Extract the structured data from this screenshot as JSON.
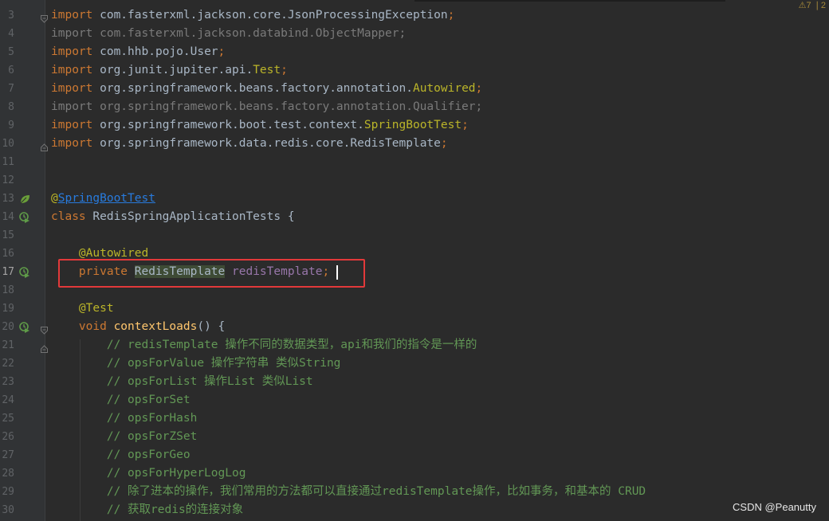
{
  "watermark": "CSDN @Peanutty",
  "top_right_indicator": "⚠7 ❘2",
  "lines": [
    {
      "n": "3",
      "segments": [
        {
          "t": "import",
          "c": "kw"
        },
        {
          "t": " com.fasterxml.jackson.core.JsonProcessingException"
        },
        {
          "t": ";",
          "c": "kw"
        }
      ],
      "fold": "open"
    },
    {
      "n": "4",
      "segments": [
        {
          "t": "import com.fasterxml.jackson.databind.ObjectMapper;",
          "c": "dim"
        }
      ]
    },
    {
      "n": "5",
      "segments": [
        {
          "t": "import",
          "c": "kw"
        },
        {
          "t": " com.hhb.pojo.User"
        },
        {
          "t": ";",
          "c": "kw"
        }
      ]
    },
    {
      "n": "6",
      "segments": [
        {
          "t": "import",
          "c": "kw"
        },
        {
          "t": " org.junit.jupiter.api."
        },
        {
          "t": "Test",
          "c": "ann"
        },
        {
          "t": ";",
          "c": "kw"
        }
      ]
    },
    {
      "n": "7",
      "segments": [
        {
          "t": "import",
          "c": "kw"
        },
        {
          "t": " org.springframework.beans.factory.annotation."
        },
        {
          "t": "Autowired",
          "c": "ann"
        },
        {
          "t": ";",
          "c": "kw"
        }
      ]
    },
    {
      "n": "8",
      "segments": [
        {
          "t": "import org.springframework.beans.factory.annotation.Qualifier;",
          "c": "dim"
        }
      ]
    },
    {
      "n": "9",
      "segments": [
        {
          "t": "import",
          "c": "kw"
        },
        {
          "t": " org.springframework.boot.test.context."
        },
        {
          "t": "SpringBootTest",
          "c": "ann"
        },
        {
          "t": ";",
          "c": "kw"
        }
      ]
    },
    {
      "n": "10",
      "segments": [
        {
          "t": "import",
          "c": "kw"
        },
        {
          "t": " org.springframework.data.redis.core.RedisTemplate"
        },
        {
          "t": ";",
          "c": "kw"
        }
      ],
      "fold": "close"
    },
    {
      "n": "11",
      "segments": []
    },
    {
      "n": "12",
      "segments": []
    },
    {
      "n": "13",
      "segments": [
        {
          "t": "@",
          "c": "ann"
        },
        {
          "t": "SpringBootTest",
          "c": "ann-link"
        }
      ],
      "icon": "leaf-icon"
    },
    {
      "n": "14",
      "segments": [
        {
          "t": "class",
          "c": "kw"
        },
        {
          "t": " RedisSpringApplicationTests {"
        }
      ],
      "icon": "run-icon"
    },
    {
      "n": "15",
      "segments": []
    },
    {
      "n": "16",
      "segments": [
        {
          "t": "    "
        },
        {
          "t": "@Autowired",
          "c": "ann"
        }
      ]
    },
    {
      "n": "17",
      "segments": [
        {
          "t": "    "
        },
        {
          "t": "private",
          "c": "kw"
        },
        {
          "t": " "
        },
        {
          "t": "RedisTemplate",
          "c": "hl"
        },
        {
          "t": " "
        },
        {
          "t": "redisTemplate",
          "c": "field"
        },
        {
          "t": ";",
          "c": "kw"
        }
      ],
      "icon": "run-icon",
      "current": true
    },
    {
      "n": "18",
      "segments": []
    },
    {
      "n": "19",
      "segments": [
        {
          "t": "    "
        },
        {
          "t": "@Test",
          "c": "ann"
        }
      ]
    },
    {
      "n": "20",
      "segments": [
        {
          "t": "    "
        },
        {
          "t": "void",
          "c": "kw"
        },
        {
          "t": " "
        },
        {
          "t": "contextLoads",
          "c": "fn"
        },
        {
          "t": "() {"
        }
      ],
      "icon": "run-icon",
      "fold": "open"
    },
    {
      "n": "21",
      "segments": [
        {
          "t": "        "
        },
        {
          "t": "// redisTemplate 操作不同的数据类型，api和我们的指令是一样的",
          "c": "cmt"
        }
      ],
      "fold": "close"
    },
    {
      "n": "22",
      "segments": [
        {
          "t": "        "
        },
        {
          "t": "// opsForValue 操作字符串 类似String",
          "c": "cmt"
        }
      ]
    },
    {
      "n": "23",
      "segments": [
        {
          "t": "        "
        },
        {
          "t": "// opsForList 操作List 类似List",
          "c": "cmt"
        }
      ]
    },
    {
      "n": "24",
      "segments": [
        {
          "t": "        "
        },
        {
          "t": "// opsForSet",
          "c": "cmt"
        }
      ]
    },
    {
      "n": "25",
      "segments": [
        {
          "t": "        "
        },
        {
          "t": "// opsForHash",
          "c": "cmt"
        }
      ]
    },
    {
      "n": "26",
      "segments": [
        {
          "t": "        "
        },
        {
          "t": "// opsForZSet",
          "c": "cmt"
        }
      ]
    },
    {
      "n": "27",
      "segments": [
        {
          "t": "        "
        },
        {
          "t": "// opsForGeo",
          "c": "cmt"
        }
      ]
    },
    {
      "n": "28",
      "segments": [
        {
          "t": "        "
        },
        {
          "t": "// opsForHyperLogLog",
          "c": "cmt"
        }
      ]
    },
    {
      "n": "29",
      "segments": [
        {
          "t": "        "
        },
        {
          "t": "// 除了进本的操作，我们常用的方法都可以直接通过redisTemplate操作，比如事务，和基本的 CRUD",
          "c": "cmt"
        }
      ]
    },
    {
      "n": "30",
      "segments": [
        {
          "t": "        "
        },
        {
          "t": "// 获取redis的连接对象",
          "c": "cmt"
        }
      ]
    }
  ]
}
